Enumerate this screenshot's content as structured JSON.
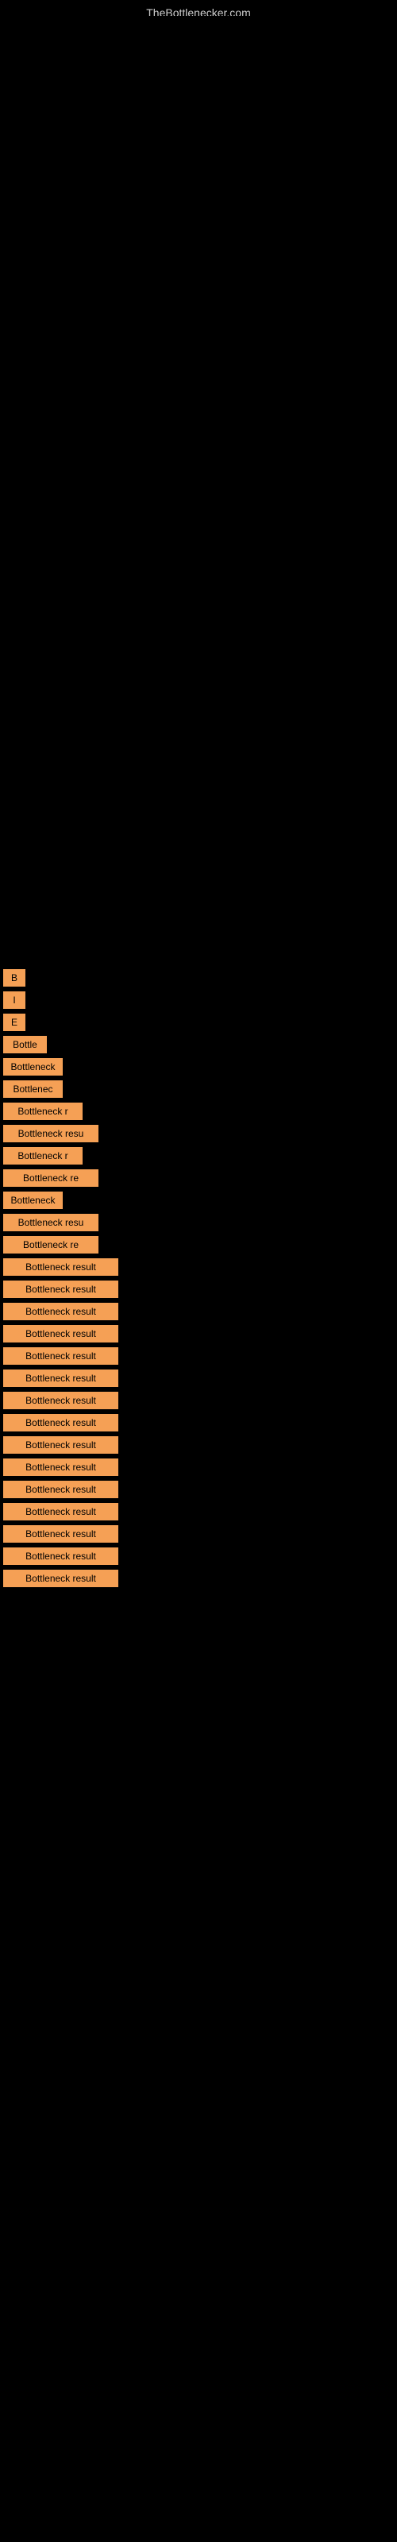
{
  "site": {
    "title": "TheBottlenecker.com"
  },
  "buttons": [
    {
      "id": 1,
      "label": "B",
      "size_class": "btn-xs"
    },
    {
      "id": 2,
      "label": "I",
      "size_class": "btn-xs"
    },
    {
      "id": 3,
      "label": "E",
      "size_class": "btn-xs"
    },
    {
      "id": 4,
      "label": "Bottle",
      "size_class": "btn-sm"
    },
    {
      "id": 5,
      "label": "Bottleneck",
      "size_class": "btn-md"
    },
    {
      "id": 6,
      "label": "Bottlenec",
      "size_class": "btn-md"
    },
    {
      "id": 7,
      "label": "Bottleneck r",
      "size_class": "btn-lg"
    },
    {
      "id": 8,
      "label": "Bottleneck resu",
      "size_class": "btn-xl"
    },
    {
      "id": 9,
      "label": "Bottleneck r",
      "size_class": "btn-lg"
    },
    {
      "id": 10,
      "label": "Bottleneck re",
      "size_class": "btn-xl"
    },
    {
      "id": 11,
      "label": "Bottleneck",
      "size_class": "btn-md"
    },
    {
      "id": 12,
      "label": "Bottleneck resu",
      "size_class": "btn-xl"
    },
    {
      "id": 13,
      "label": "Bottleneck re",
      "size_class": "btn-xl"
    },
    {
      "id": 14,
      "label": "Bottleneck result",
      "size_class": "btn-full"
    },
    {
      "id": 15,
      "label": "Bottleneck result",
      "size_class": "btn-full"
    },
    {
      "id": 16,
      "label": "Bottleneck result",
      "size_class": "btn-full"
    },
    {
      "id": 17,
      "label": "Bottleneck result",
      "size_class": "btn-full"
    },
    {
      "id": 18,
      "label": "Bottleneck result",
      "size_class": "btn-full"
    },
    {
      "id": 19,
      "label": "Bottleneck result",
      "size_class": "btn-full"
    },
    {
      "id": 20,
      "label": "Bottleneck result",
      "size_class": "btn-full"
    },
    {
      "id": 21,
      "label": "Bottleneck result",
      "size_class": "btn-full"
    },
    {
      "id": 22,
      "label": "Bottleneck result",
      "size_class": "btn-full"
    },
    {
      "id": 23,
      "label": "Bottleneck result",
      "size_class": "btn-full"
    },
    {
      "id": 24,
      "label": "Bottleneck result",
      "size_class": "btn-full"
    },
    {
      "id": 25,
      "label": "Bottleneck result",
      "size_class": "btn-full"
    },
    {
      "id": 26,
      "label": "Bottleneck result",
      "size_class": "btn-full"
    },
    {
      "id": 27,
      "label": "Bottleneck result",
      "size_class": "btn-full"
    },
    {
      "id": 28,
      "label": "Bottleneck result",
      "size_class": "btn-full"
    }
  ]
}
